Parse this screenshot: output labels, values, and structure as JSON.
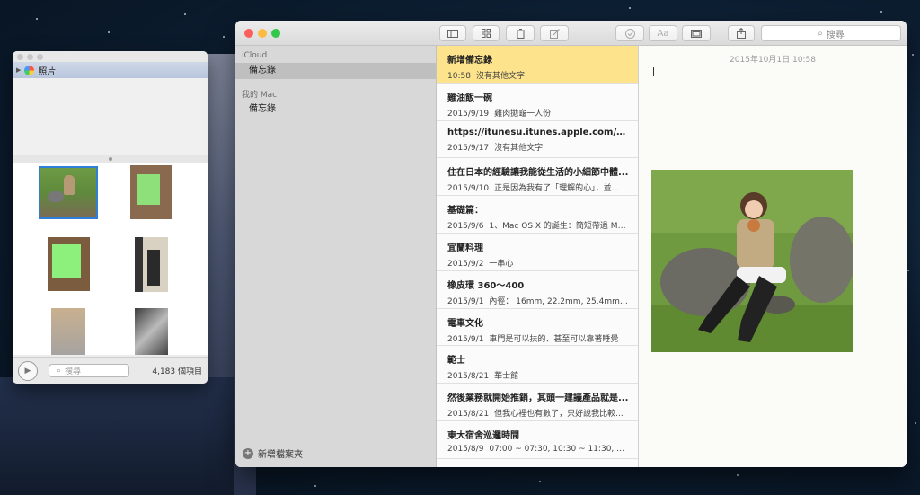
{
  "photo_browser": {
    "source_label": "照片",
    "search_placeholder": "搜尋",
    "item_count": "4,183 個項目"
  },
  "notes_app": {
    "toolbar": {
      "search_placeholder": "搜尋"
    },
    "sidebar": {
      "sections": [
        {
          "header": "iCloud",
          "items": [
            "備忘錄"
          ]
        },
        {
          "header": "我的 Mac",
          "items": [
            "備忘錄"
          ]
        }
      ],
      "new_folder_label": "新增檔案夾"
    },
    "notes": [
      {
        "title": "新增備忘錄",
        "date": "10:58",
        "preview": "沒有其他文字"
      },
      {
        "title": "雞油飯一碗",
        "date": "2015/9/19",
        "preview": "雞肉拋龜一人份"
      },
      {
        "title": "https://itunesu.itunes.apple.com/enrol...",
        "date": "2015/9/17",
        "preview": "沒有其他文字"
      },
      {
        "title": "住在日本的經驗讓我能從生活的小細節中體...",
        "date": "2015/9/10",
        "preview": "正是因為我有了「理解的心」，並..."
      },
      {
        "title": "基礎篇：",
        "date": "2015/9/6",
        "preview": "1、Mac OS X 的誕生：簡短帶過 Ma..."
      },
      {
        "title": "宜蘭料理",
        "date": "2015/9/2",
        "preview": "一串心"
      },
      {
        "title": "橡皮環 360～400",
        "date": "2015/9/1",
        "preview": "內徑： 16mm, 22.2mm, 25.4mm, 3..."
      },
      {
        "title": "電車文化",
        "date": "2015/9/1",
        "preview": "車門是可以扶的、甚至可以靠著睡覺"
      },
      {
        "title": "範士",
        "date": "2015/8/21",
        "preview": "華士館"
      },
      {
        "title": "然後業務就開始推銷，其頭一建議產品就是...",
        "date": "2015/8/21",
        "preview": "但我心裡也有數了，只好說我比較..."
      },
      {
        "title": "東大宿舍巡邏時間",
        "date": "2015/8/9",
        "preview": "07:00 ~ 07:30, 10:30 ~ 11:30, 15:3..."
      }
    ],
    "selected_note_index": 0,
    "editor": {
      "timestamp": "2015年10月1日 10:58"
    }
  }
}
